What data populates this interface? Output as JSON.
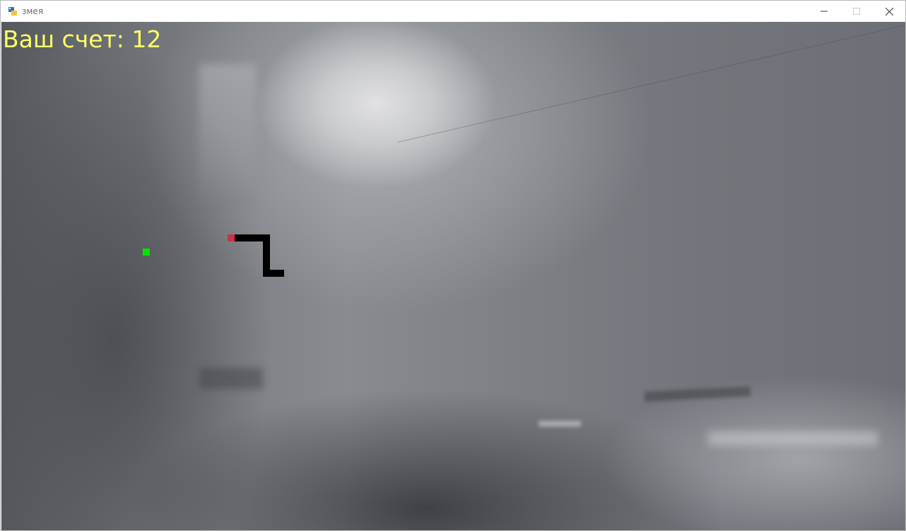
{
  "window": {
    "title": "змея",
    "icon": "python-icon",
    "controls": {
      "minimize_icon": "minimize-icon",
      "maximize_icon": "maximize-icon",
      "close_icon": "close-icon"
    }
  },
  "game": {
    "score_text": "Ваш счет: 12",
    "colors": {
      "score": "#ffff66",
      "food": "#00e400",
      "snake_head": "#c8324a",
      "snake_body": "#000000"
    }
  }
}
